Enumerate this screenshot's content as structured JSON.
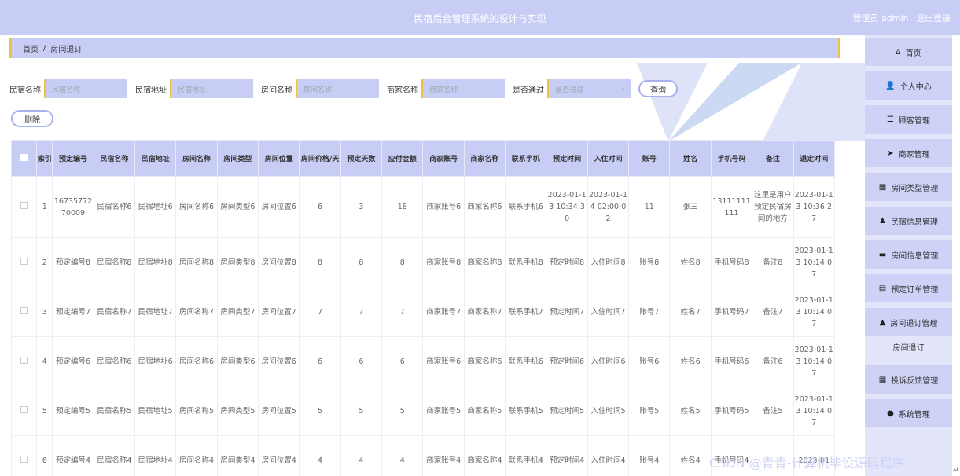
{
  "app": {
    "title": "民宿后台管理系统的设计与实现",
    "user_label": "管理员 admin",
    "logout_label": "退出登录"
  },
  "breadcrumb": {
    "home": "首页",
    "separator": "/",
    "current": "房间退订"
  },
  "sidebar": {
    "items": [
      {
        "label": "首页",
        "icon": "home-icon",
        "glyph": "⌂"
      },
      {
        "label": "个人中心",
        "icon": "user-icon",
        "glyph": "👤"
      },
      {
        "label": "顾客管理",
        "icon": "list-icon",
        "glyph": "☰"
      },
      {
        "label": "商家管理",
        "icon": "send-icon",
        "glyph": "➤"
      },
      {
        "label": "房间类型管理",
        "icon": "grid-icon",
        "glyph": "▦"
      },
      {
        "label": "民宿信息管理",
        "icon": "person-icon",
        "glyph": "♟"
      },
      {
        "label": "房间信息管理",
        "icon": "monitor-icon",
        "glyph": "▬"
      },
      {
        "label": "预定订单管理",
        "icon": "clipboard-icon",
        "glyph": "▤"
      },
      {
        "label": "房间退订管理",
        "icon": "thumb-icon",
        "glyph": "▲"
      },
      {
        "label": "房间退订",
        "icon": "",
        "glyph": ""
      },
      {
        "label": "投诉反馈管理",
        "icon": "grid-icon",
        "glyph": "▦"
      },
      {
        "label": "系统管理",
        "icon": "location-icon",
        "glyph": "●"
      }
    ]
  },
  "search": {
    "fields": [
      {
        "label": "民宿名称",
        "placeholder": "民宿名称"
      },
      {
        "label": "民宿地址",
        "placeholder": "民宿地址"
      },
      {
        "label": "房间名称",
        "placeholder": "房间名称"
      },
      {
        "label": "商家名称",
        "placeholder": "商家名称"
      }
    ],
    "approved": {
      "label": "是否通过",
      "placeholder": "是否通过"
    },
    "query_label": "查询",
    "delete_label": "删除"
  },
  "table": {
    "headers": [
      "索引",
      "预定编号",
      "民宿名称",
      "民宿地址",
      "房间名称",
      "房间类型",
      "房间位置",
      "房间价格/天",
      "预定天数",
      "应付金额",
      "商家账号",
      "商家名称",
      "联系手机",
      "预定时间",
      "入住时间",
      "账号",
      "姓名",
      "手机号码",
      "备注",
      "退定时间"
    ],
    "rows": [
      [
        "1",
        "1673577270009",
        "民宿名称6",
        "民宿地址6",
        "房间名称6",
        "房间类型6",
        "房间位置6",
        "6",
        "3",
        "18",
        "商家账号6",
        "商家名称6",
        "联系手机6",
        "2023-01-13 10:34:30",
        "2023-01-14 02:00:02",
        "11",
        "张三",
        "13111111111",
        "这里是用户预定民宿房间的地方",
        "2023-01-13 10:36:27"
      ],
      [
        "2",
        "预定编号8",
        "民宿名称8",
        "民宿地址8",
        "房间名称8",
        "房间类型8",
        "房间位置8",
        "8",
        "8",
        "8",
        "商家账号8",
        "商家名称8",
        "联系手机8",
        "预定时间8",
        "入住时间8",
        "账号8",
        "姓名8",
        "手机号码8",
        "备注8",
        "2023-01-13 10:14:07"
      ],
      [
        "3",
        "预定编号7",
        "民宿名称7",
        "民宿地址7",
        "房间名称7",
        "房间类型7",
        "房间位置7",
        "7",
        "7",
        "7",
        "商家账号7",
        "商家名称7",
        "联系手机7",
        "预定时间7",
        "入住时间7",
        "账号7",
        "姓名7",
        "手机号码7",
        "备注7",
        "2023-01-13 10:14:07"
      ],
      [
        "4",
        "预定编号6",
        "民宿名称6",
        "民宿地址6",
        "房间名称6",
        "房间类型6",
        "房间位置6",
        "6",
        "6",
        "6",
        "商家账号6",
        "商家名称6",
        "联系手机6",
        "预定时间6",
        "入住时间6",
        "账号6",
        "姓名6",
        "手机号码6",
        "备注6",
        "2023-01-13 10:14:07"
      ],
      [
        "5",
        "预定编号5",
        "民宿名称5",
        "民宿地址5",
        "房间名称5",
        "房间类型5",
        "房间位置5",
        "5",
        "5",
        "5",
        "商家账号5",
        "商家名称5",
        "联系手机5",
        "预定时间5",
        "入住时间5",
        "账号5",
        "姓名5",
        "手机号码5",
        "备注5",
        "2023-01-13 10:14:07"
      ],
      [
        "6",
        "预定编号4",
        "民宿名称4",
        "民宿地址4",
        "房间名称4",
        "房间类型4",
        "房间位置4",
        "4",
        "4",
        "4",
        "商家账号4",
        "商家名称4",
        "联系手机4",
        "预定时间4",
        "入住时间4",
        "账号4",
        "姓名4",
        "手机号码4",
        "",
        "2023-01"
      ]
    ]
  },
  "watermark": "CSDN @青青-计算机毕设源码程序",
  "corner_mark": "↵",
  "colors": {
    "primary": "#c8cdf5",
    "accent": "#f0c040",
    "sidebar": "#ced2f7"
  }
}
